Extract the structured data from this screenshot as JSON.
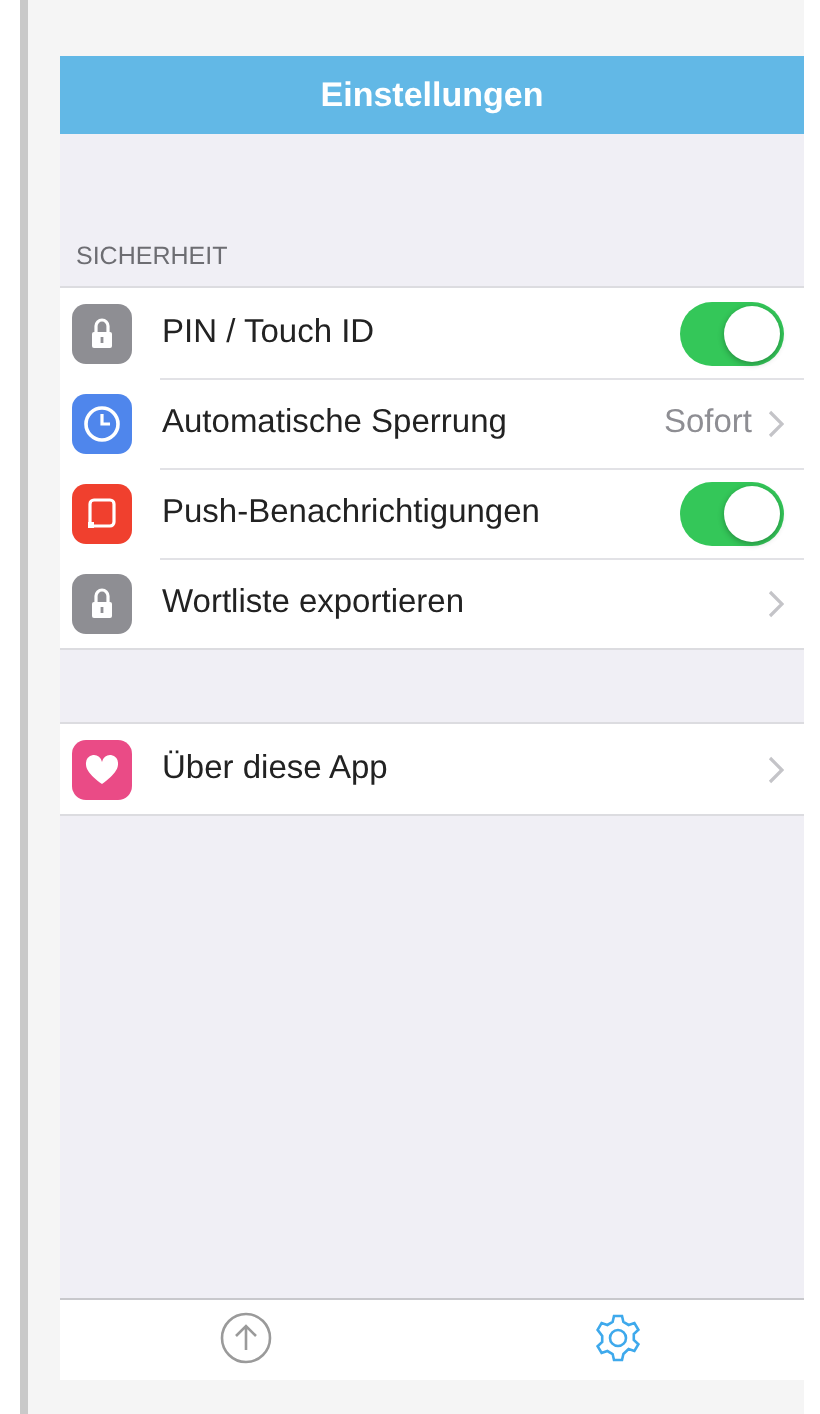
{
  "navigation_bar": {
    "title": "Einstellungen"
  },
  "sections": [
    {
      "header": "SICHERHEIT",
      "rows": [
        {
          "kind": "toggle",
          "label": "PIN / Touch ID",
          "on": true
        },
        {
          "kind": "disclosure",
          "label": "Automatische Sperrung",
          "value": "Sofort"
        },
        {
          "kind": "toggle",
          "label": "Push-Benachrichtigungen",
          "on": true
        },
        {
          "kind": "disclosure",
          "label": "Wortliste exportieren"
        }
      ]
    },
    {
      "rows": [
        {
          "kind": "disclosure",
          "label": "Über diese App"
        }
      ]
    }
  ],
  "tab_bar": {
    "tabs": [
      {
        "selected": false
      },
      {
        "selected": true
      }
    ]
  }
}
